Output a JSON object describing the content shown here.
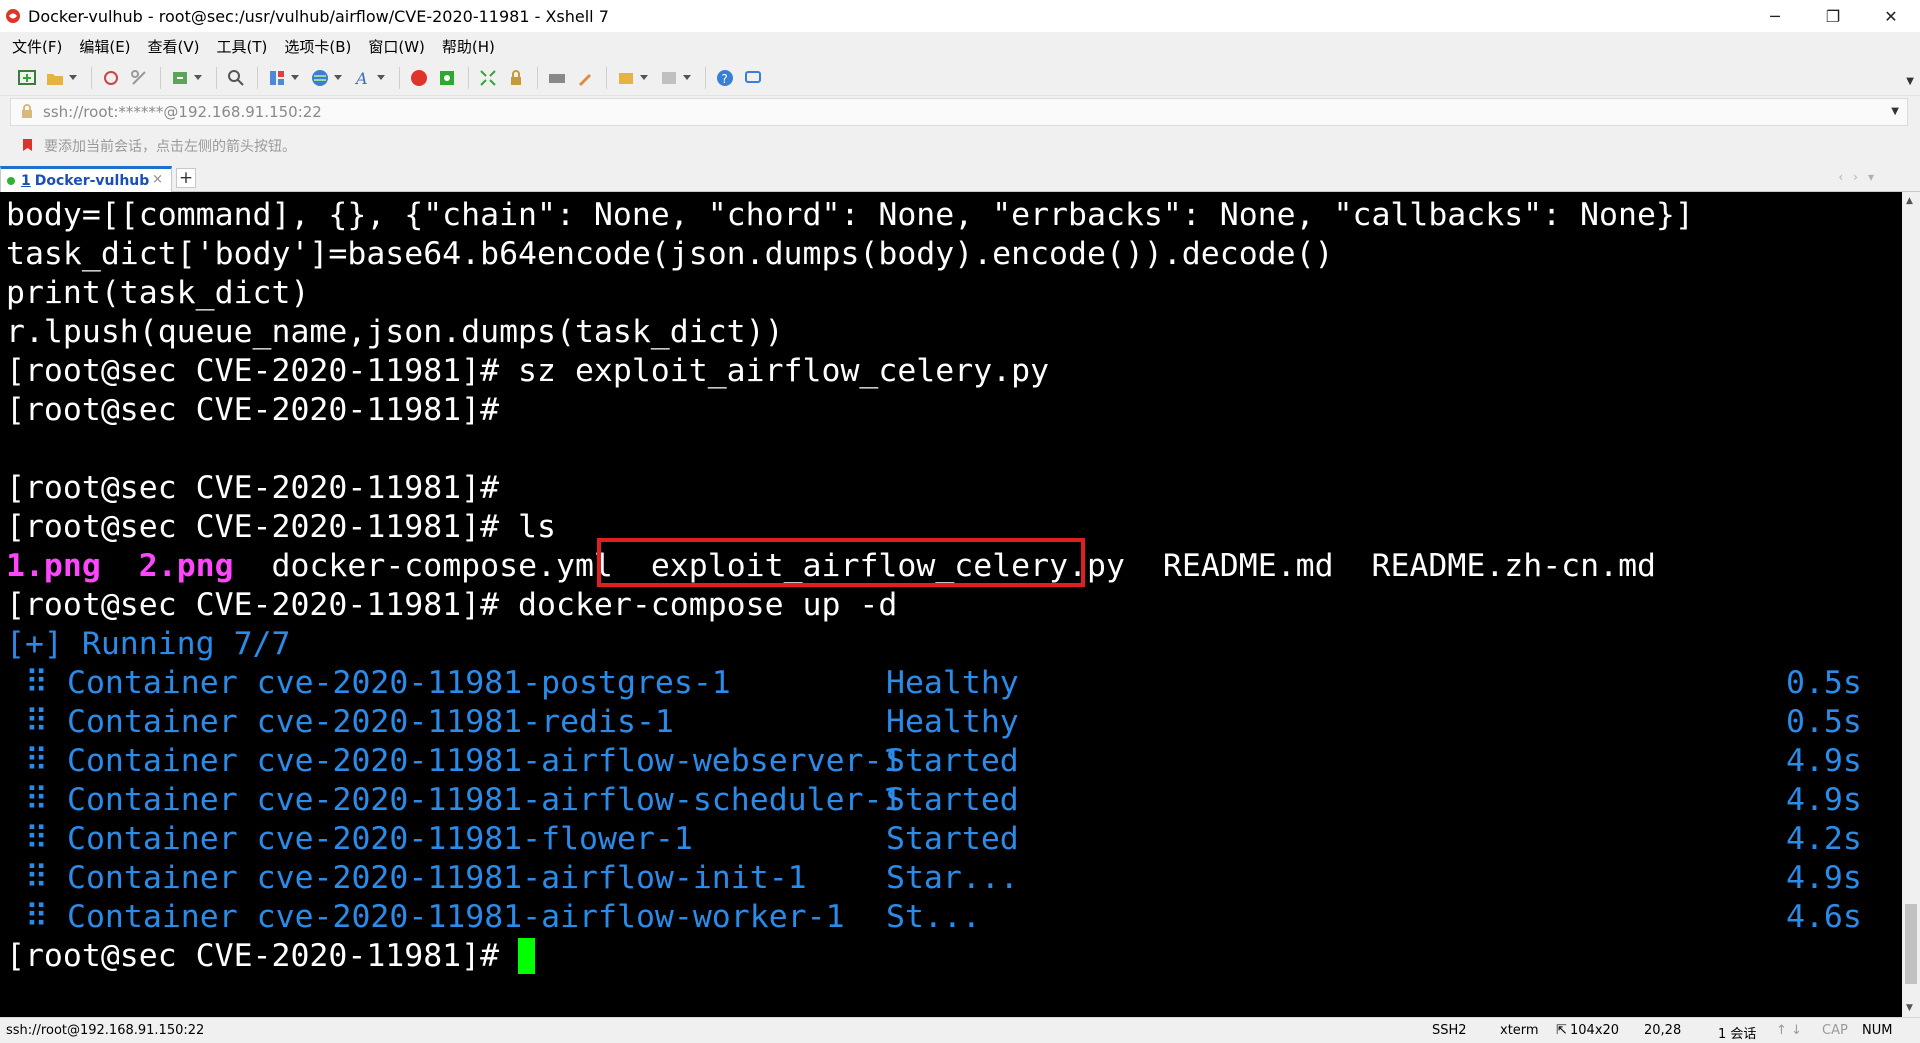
{
  "window": {
    "title": "Docker-vulhub - root@sec:/usr/vulhub/airflow/CVE-2020-11981 - Xshell 7",
    "minimize": "─",
    "restore": "❐",
    "close": "✕"
  },
  "menu": [
    "文件(F)",
    "编辑(E)",
    "查看(V)",
    "工具(T)",
    "选项卡(B)",
    "窗口(W)",
    "帮助(H)"
  ],
  "address": {
    "value": "ssh://root:******@192.168.91.150:22"
  },
  "hint": "要添加当前会话，点击左侧的箭头按钮。",
  "tab": {
    "number": "1",
    "label": "Docker-vulhub",
    "close": "×",
    "add": "+"
  },
  "terminal": {
    "lines": [
      "body=[[command], {}, {\"chain\": None, \"chord\": None, \"errbacks\": None, \"callbacks\": None}]",
      "task_dict['body']=base64.b64encode(json.dumps(body).encode()).decode()",
      "print(task_dict)",
      "r.lpush(queue_name,json.dumps(task_dict))",
      "[root@sec CVE-2020-11981]# sz exploit_airflow_celery.py",
      "[root@sec CVE-2020-11981]#",
      "",
      "[root@sec CVE-2020-11981]#",
      "[root@sec CVE-2020-11981]# ls"
    ],
    "ls_output": {
      "png1": "1.png",
      "png2": "2.png",
      "compose": "docker-compose.yml",
      "exploit": "exploit_airflow_celery.py",
      "readme": "README.md",
      "readme_cn": "README.zh-cn.md"
    },
    "compose_cmd": "[root@sec CVE-2020-11981]# docker-compose up -d",
    "running": "[+] Running 7/7",
    "containers": [
      {
        "name": " ⠿ Container cve-2020-11981-postgres-1",
        "status": "Healthy",
        "time": "0.5s"
      },
      {
        "name": " ⠿ Container cve-2020-11981-redis-1",
        "status": "Healthy",
        "time": "0.5s"
      },
      {
        "name": " ⠿ Container cve-2020-11981-airflow-webserver-1",
        "status": "Started",
        "time": "4.9s"
      },
      {
        "name": " ⠿ Container cve-2020-11981-airflow-scheduler-1",
        "status": "Started",
        "time": "4.9s"
      },
      {
        "name": " ⠿ Container cve-2020-11981-flower-1",
        "status": "Started",
        "time": "4.2s"
      },
      {
        "name": " ⠿ Container cve-2020-11981-airflow-init-1",
        "status": "Star...",
        "time": "4.9s"
      },
      {
        "name": " ⠿ Container cve-2020-11981-airflow-worker-1",
        "status": "St...",
        "time": "4.6s"
      }
    ],
    "prompt": "[root@sec CVE-2020-11981]# "
  },
  "status": {
    "connection": "ssh://root@192.168.91.150:22",
    "protocol": "SSH2",
    "term": "xterm",
    "size": "104x20",
    "position": "20,28",
    "sessions": "1 会话",
    "cap": "CAP",
    "num": "NUM"
  },
  "colors": {
    "terminal_bg": "#000000",
    "terminal_fg": "#ffffff",
    "magenta": "#ff46ff",
    "blue": "#2a8be8",
    "cursor": "#00ff00",
    "highlight": "#e02020",
    "tab_accent": "#1f6fd1"
  }
}
